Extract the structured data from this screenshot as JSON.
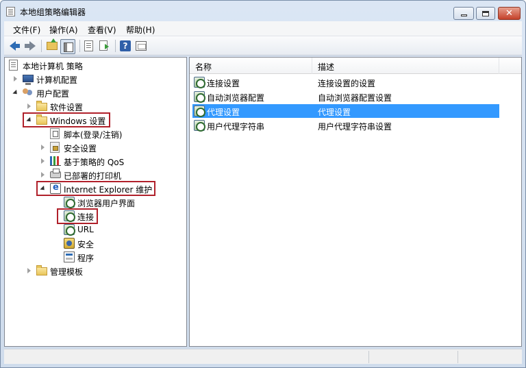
{
  "window": {
    "title": "本地组策略编辑器"
  },
  "window_controls": {
    "close_glyph": "✕"
  },
  "menu": [
    {
      "label": "文件(F)"
    },
    {
      "label": "操作(A)"
    },
    {
      "label": "查看(V)"
    },
    {
      "label": "帮助(H)"
    }
  ],
  "toolbar": {
    "help_glyph": "?"
  },
  "tree": {
    "root": "本地计算机 策略",
    "computer_config": "计算机配置",
    "user_config": "用户配置",
    "software_settings": "软件设置",
    "windows_settings": "Windows 设置",
    "scripts": "脚本(登录/注销)",
    "security_settings": "安全设置",
    "qos": "基于策略的 QoS",
    "deployed_printers": "已部署的打印机",
    "ie_maintenance": "Internet Explorer 维护",
    "browser_ui": "浏览器用户界面",
    "connection": "连接",
    "url": "URL",
    "security": "安全",
    "programs": "程序",
    "admin_templates": "管理模板"
  },
  "list": {
    "columns": [
      "名称",
      "描述"
    ],
    "rows": [
      {
        "name": "连接设置",
        "desc": "连接设置的设置",
        "selected": false
      },
      {
        "name": "自动浏览器配置",
        "desc": "自动浏览器配置设置",
        "selected": false
      },
      {
        "name": "代理设置",
        "desc": "代理设置",
        "selected": true
      },
      {
        "name": "用户代理字符串",
        "desc": "用户代理字符串设置",
        "selected": false
      }
    ]
  },
  "colors": {
    "selection": "#3399ff",
    "highlight_box": "#b0202a"
  }
}
